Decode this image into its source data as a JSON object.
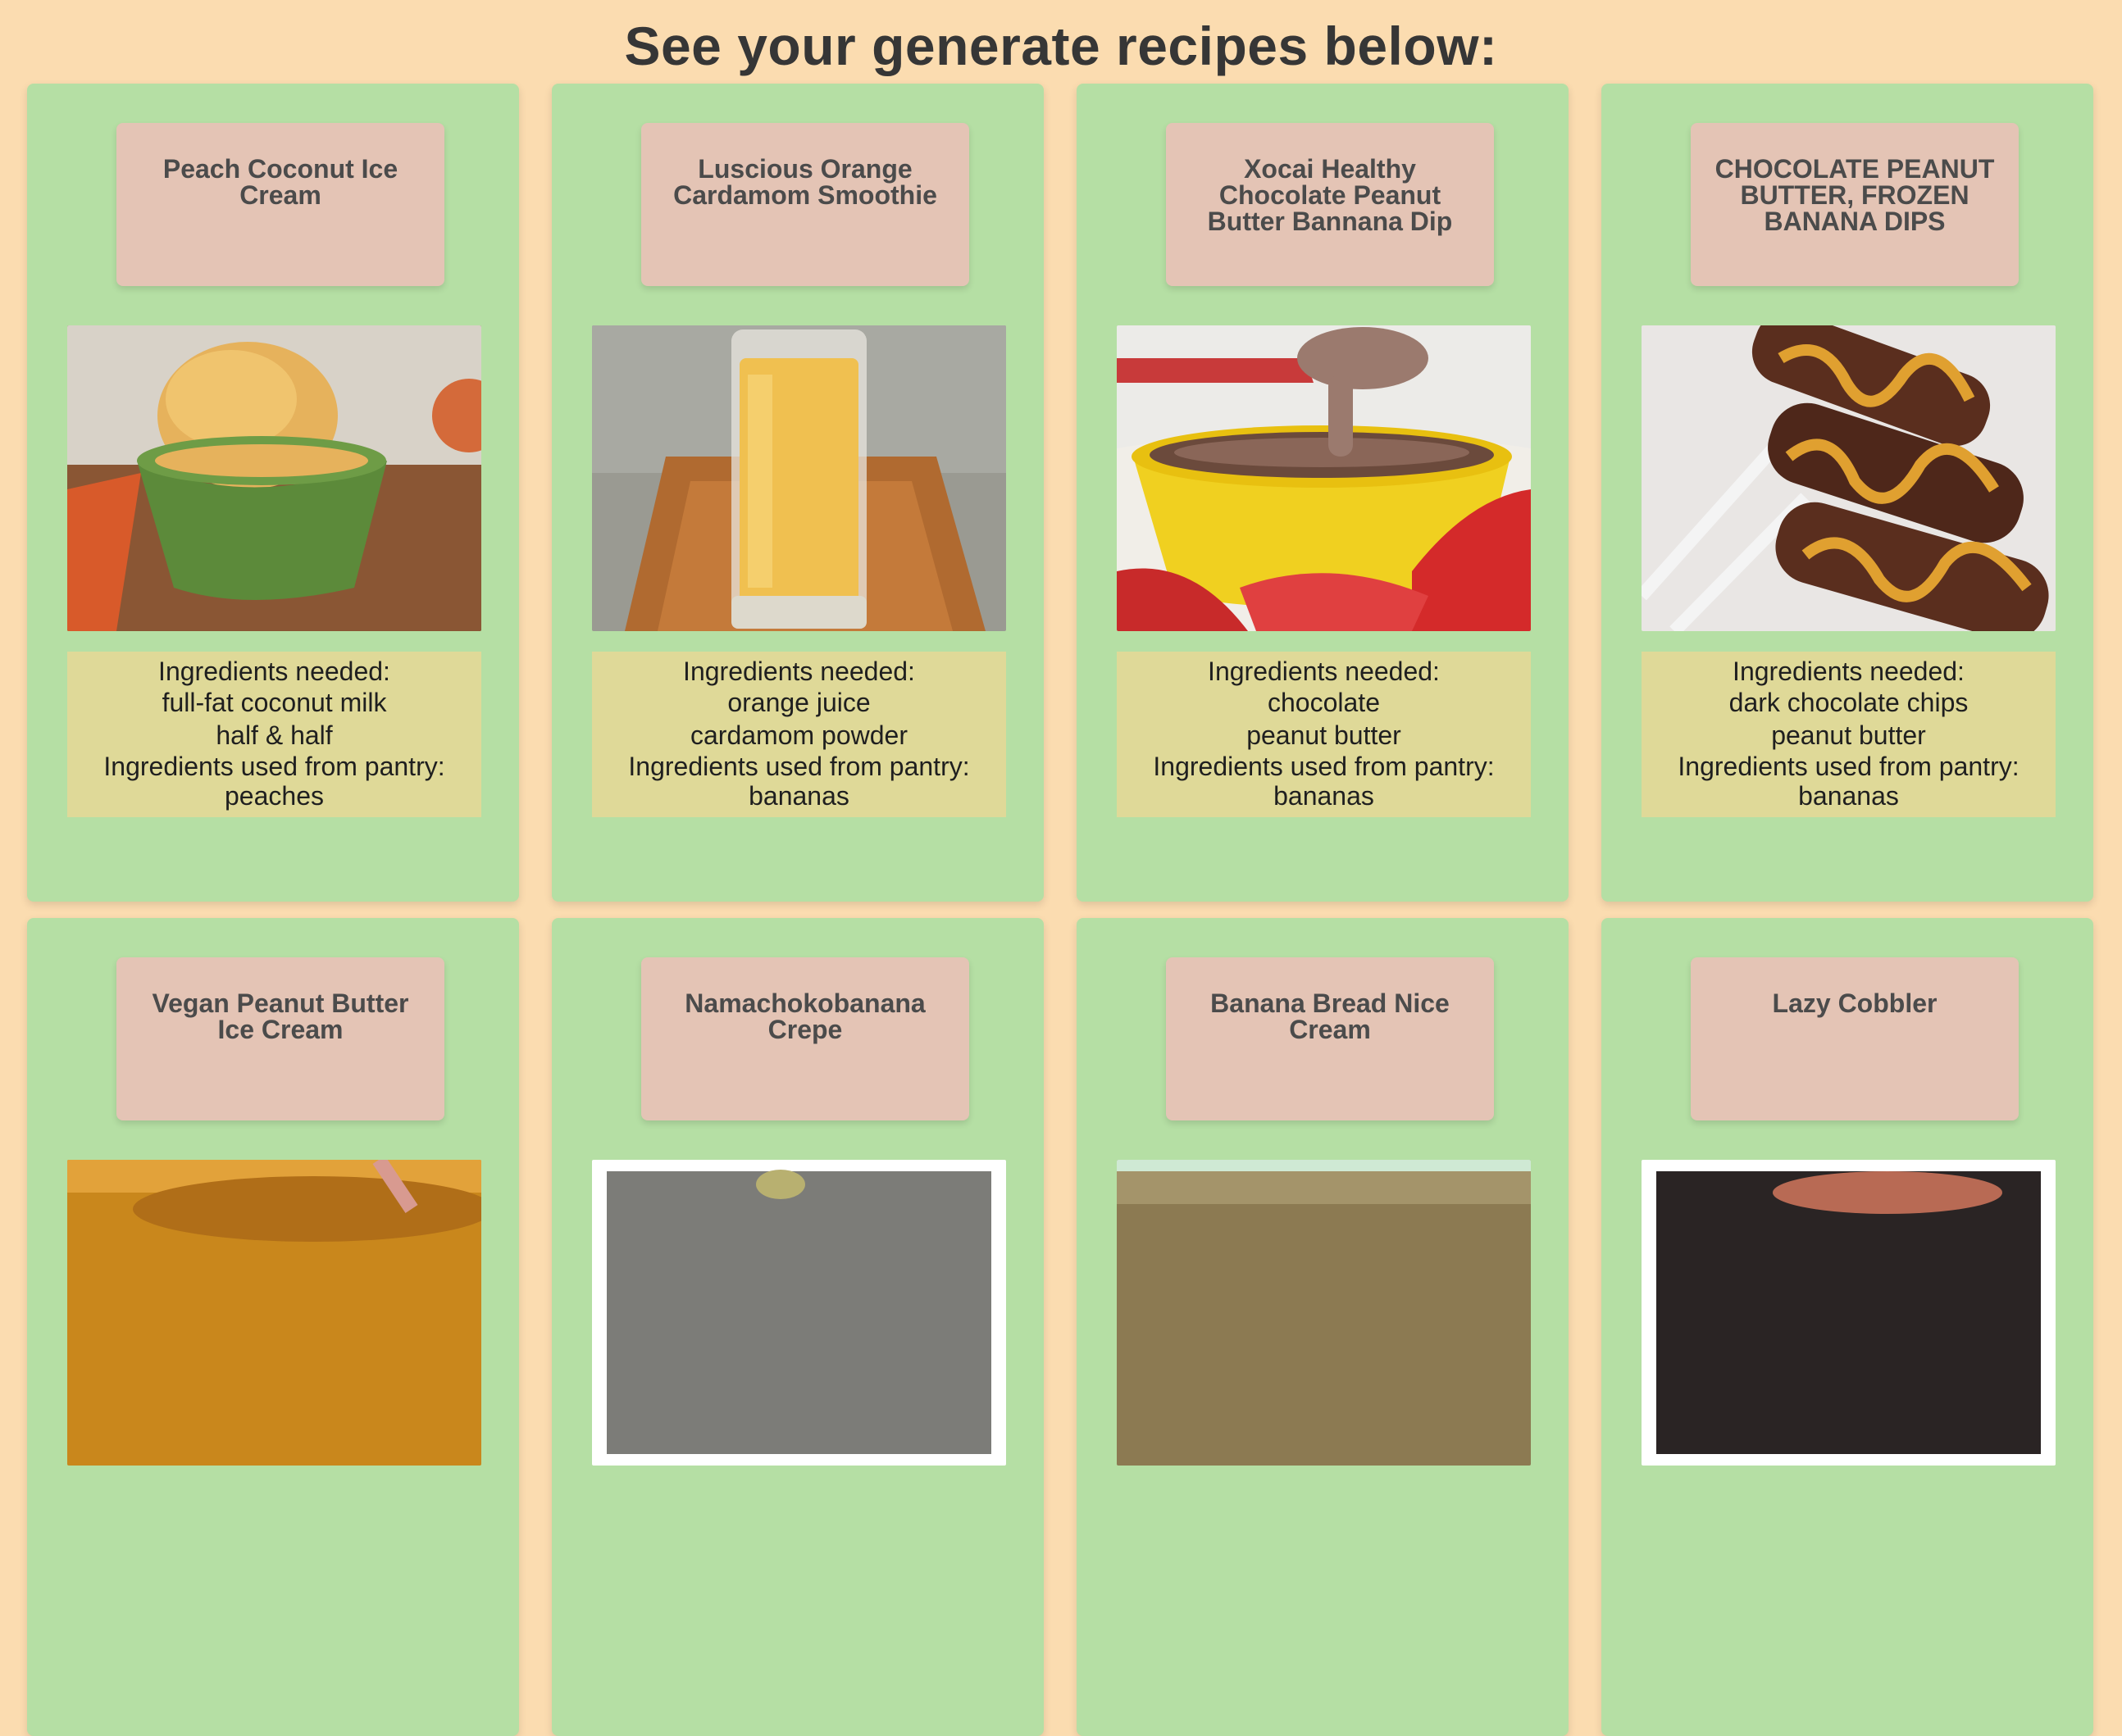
{
  "page": {
    "heading": "See your generate recipes below:",
    "background_color": "#fbdcb0",
    "card_color": "#b5dfa4",
    "title_box_color": "#e4c4b5",
    "info_box_color": "#dfd998"
  },
  "labels": {
    "needed": "Ingredients needed:",
    "pantry": "Ingredients used from pantry:"
  },
  "recipes": [
    {
      "title": "Peach Coconut Ice Cream",
      "image_icon": "ice-cream-bowl",
      "ingredients_needed": [
        "full-fat coconut milk",
        "half & half"
      ],
      "pantry": [
        "peaches"
      ]
    },
    {
      "title": "Luscious Orange Cardamom Smoothie",
      "image_icon": "smoothie-glass",
      "ingredients_needed": [
        "orange juice",
        "cardamom powder"
      ],
      "pantry": [
        "bananas"
      ]
    },
    {
      "title": "Xocai Healthy Chocolate Peanut Butter Bannana Dip",
      "image_icon": "dip-bowl",
      "ingredients_needed": [
        "chocolate",
        "peanut butter"
      ],
      "pantry": [
        "bananas"
      ]
    },
    {
      "title": "CHOCOLATE PEANUT BUTTER, FROZEN BANANA DIPS",
      "image_icon": "banana-pops",
      "ingredients_needed": [
        "dark chocolate chips",
        "peanut butter"
      ],
      "pantry": [
        "bananas"
      ]
    },
    {
      "title": "Vegan Peanut Butter Ice Cream",
      "image_icon": "ice-cream",
      "ingredients_needed": [],
      "pantry": []
    },
    {
      "title": "Namachokobanana Crepe",
      "image_icon": "crepe",
      "ingredients_needed": [],
      "pantry": []
    },
    {
      "title": "Banana Bread Nice Cream",
      "image_icon": "nice-cream",
      "ingredients_needed": [],
      "pantry": []
    },
    {
      "title": "Lazy Cobbler",
      "image_icon": "cobbler",
      "ingredients_needed": [],
      "pantry": []
    }
  ]
}
